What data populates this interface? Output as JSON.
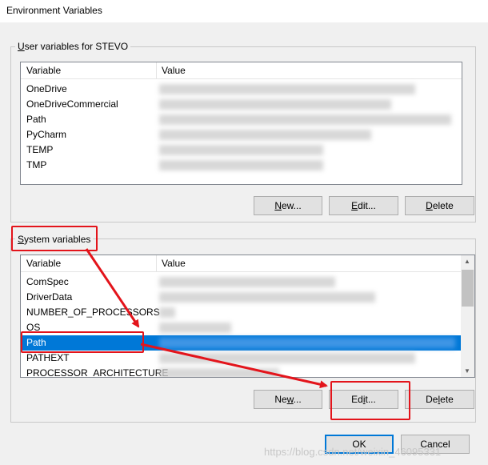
{
  "window": {
    "title": "Environment Variables"
  },
  "user_group": {
    "label_prefix": "U",
    "label_rest": "ser variables for STEVO",
    "columns": [
      "Variable",
      "Value"
    ],
    "rows": [
      {
        "name": "OneDrive"
      },
      {
        "name": "OneDriveCommercial"
      },
      {
        "name": "Path"
      },
      {
        "name": "PyCharm"
      },
      {
        "name": "TEMP"
      },
      {
        "name": "TMP"
      }
    ],
    "buttons": {
      "new_u": "N",
      "new_rest": "ew...",
      "edit_u": "E",
      "edit_rest": "dit...",
      "delete_u": "D",
      "delete_rest": "elete"
    }
  },
  "system_group": {
    "label_prefix": "S",
    "label_rest": "ystem variables",
    "columns": [
      "Variable",
      "Value"
    ],
    "rows": [
      {
        "name": "ComSpec"
      },
      {
        "name": "DriverData"
      },
      {
        "name": "NUMBER_OF_PROCESSORS"
      },
      {
        "name": "OS"
      },
      {
        "name": "Path",
        "selected": true
      },
      {
        "name": "PATHEXT"
      },
      {
        "name": "PROCESSOR_ARCHITECTURE"
      }
    ],
    "buttons": {
      "new_pre": "Ne",
      "new_u": "w",
      "new_rest": "...",
      "edit_pre": "Ed",
      "edit_u": "i",
      "edit_rest": "t...",
      "delete_pre": "De",
      "delete_u": "l",
      "delete_rest": "ete"
    }
  },
  "dialog_buttons": {
    "ok": "OK",
    "cancel": "Cancel"
  },
  "watermark": "https://blog.csdn.net/weixin_46095331",
  "colors": {
    "selection": "#0078d7",
    "annotation": "#e3141b"
  }
}
